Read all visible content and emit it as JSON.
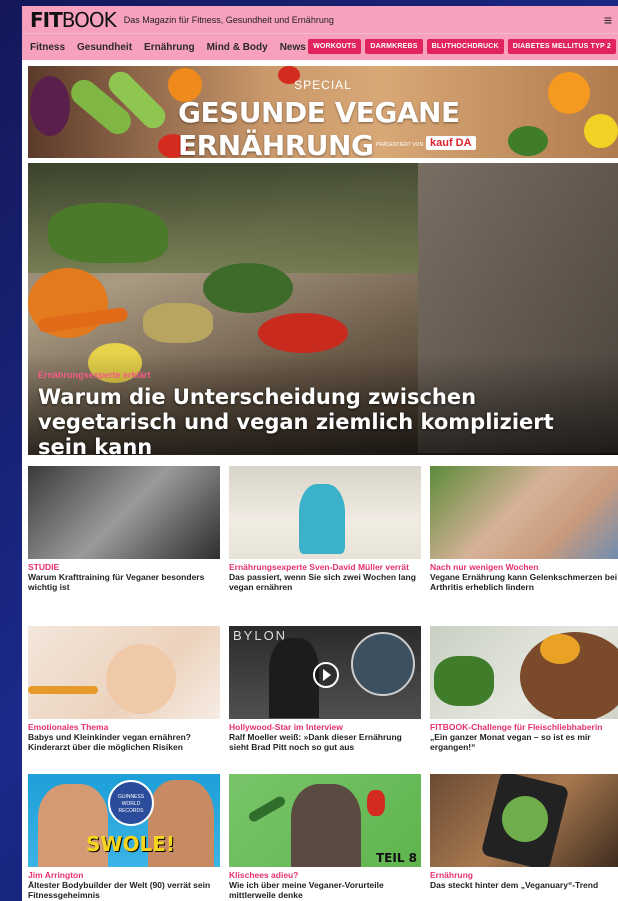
{
  "header": {
    "logo_fit": "FIT",
    "logo_book": "BOOK",
    "tagline": "Das Magazin für Fitness, Gesundheit und Ernährung",
    "menu_icon": "hamburger-icon"
  },
  "nav": {
    "links": [
      "Fitness",
      "Gesundheit",
      "Ernährung",
      "Mind & Body",
      "News"
    ],
    "pills": [
      "WORKOUTS",
      "DARMKREBS",
      "BLUTHOCHDRUCK",
      "DIABETES MELLITUS TYP 2"
    ]
  },
  "banner": {
    "special": "SPECIAL",
    "title": "GESUNDE VEGANE ERNÄHRUNG",
    "presented": "PRÄSENTIERT VON",
    "brand": "kauf DA"
  },
  "hero": {
    "kicker": "Ernährungsexperte erklärt",
    "title": "Warum die Unterscheidung zwischen vegetarisch und vegan ziemlich kompliziert sein kann"
  },
  "cards": [
    {
      "kicker": "STUDIE",
      "title": "Warum Krafttraining für Veganer besonders wichtig ist"
    },
    {
      "kicker": "Ernährungsexperte Sven-David Müller verrät",
      "title": "Das passiert, wenn Sie sich zwei Wochen lang vegan ernähren"
    },
    {
      "kicker": "Nach nur wenigen Wochen",
      "title": "Vegane Ernährung kann Gelenkschmerzen bei Arthritis erheblich lindern"
    },
    {
      "kicker": "Emotionales Thema",
      "title": "Babys und Kleinkinder vegan ernähren? Kinderarzt über die möglichen Risiken"
    },
    {
      "kicker": "Hollywood-Star im Interview",
      "title": "Ralf Moeller weiß: »Dank dieser Ernährung sieht Brad Pitt noch so gut aus"
    },
    {
      "kicker": "FITBOOK-Challenge für Fleischliebhaberin",
      "title": "„Ein ganzer Monat vegan – so ist es mir ergangen!“"
    },
    {
      "kicker": "Jim Arrington",
      "title": "Ältester Bodybuilder der Welt (90) verrät sein Fitnessgeheimnis"
    },
    {
      "kicker": "Klischees adieu?",
      "title": "Wie ich über meine Veganer-Vorurteile mittlerweile denke"
    },
    {
      "kicker": "Ernährung",
      "title": "Das steckt hinter dem „Veganuary“-Trend"
    }
  ],
  "thumb_text": {
    "guinness": "GUINNESS WORLD RECORDS",
    "swole": "SWOLE!",
    "teil": "TEIL 8",
    "babylon": "BYLON"
  },
  "colors": {
    "header_pink": "#f7a1bd",
    "accent": "#e7316a",
    "pill": "#e1245f"
  }
}
